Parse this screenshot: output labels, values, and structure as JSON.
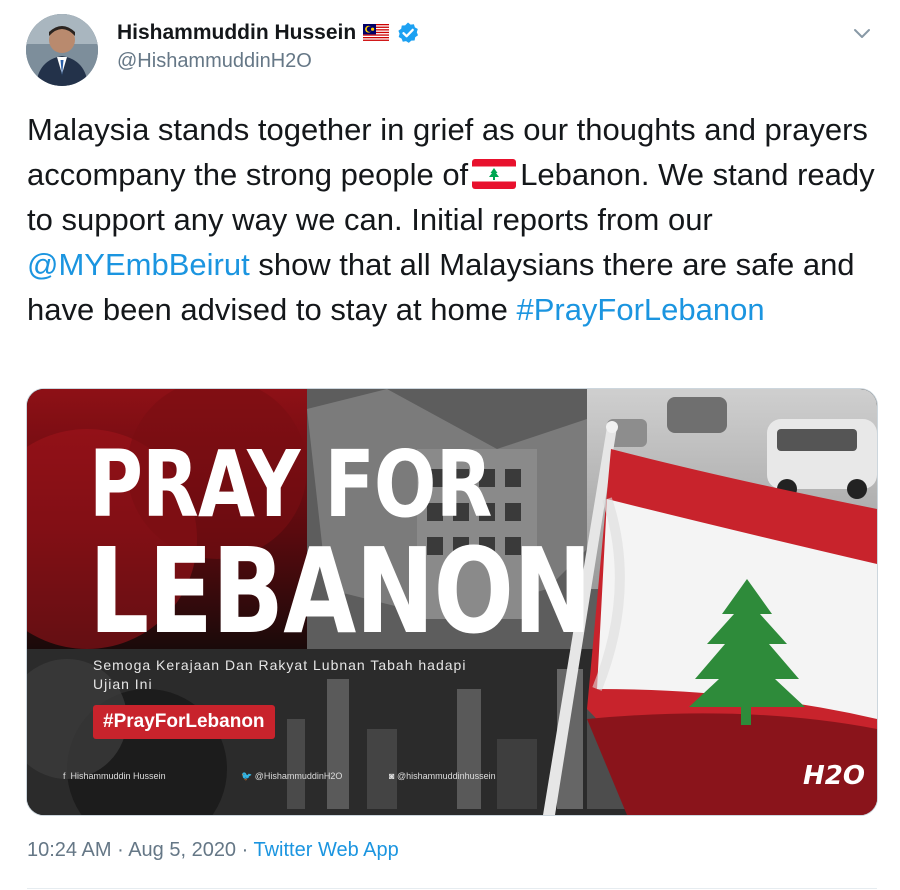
{
  "author": {
    "display_name": "Hishammuddin Hussein",
    "handle": "@HishammuddinH2O",
    "flag_icon": "malaysia-flag-icon",
    "verified_icon": "verified-badge-icon"
  },
  "tweet": {
    "text_part1": "Malaysia stands together in grief as our thoughts and prayers accompany the strong people of",
    "flag_emoji_icon": "lebanon-flag-icon",
    "text_part2": "Lebanon. We stand ready to support any way we can. Initial reports from our",
    "mention": "@MYEmbBeirut",
    "text_part3": "show that all Malaysians there are safe and have been advised to stay at home",
    "hashtag": "#PrayForLebanon"
  },
  "media": {
    "title_line1": "PRAY FOR",
    "title_line2": "LEBANON",
    "subtitle": "Semoga Kerajaan Dan Rakyat Lubnan Tabah hadapi Ujian Ini",
    "badge": "#PrayForLebanon",
    "social_facebook": "Hishammuddin Hussein",
    "social_twitter": "@HishammuddinH2O",
    "social_instagram": "@hishammuddinhussein",
    "logo": "H2O"
  },
  "meta": {
    "time": "10:24 AM",
    "sep1": " · ",
    "date": "Aug 5, 2020",
    "sep2": " · ",
    "app": "Twitter Web App"
  },
  "colors": {
    "link": "#1b95e0",
    "secondary_text": "#657786",
    "lebanon_red": "#c8232c",
    "cedar_green": "#2e8b3a"
  }
}
